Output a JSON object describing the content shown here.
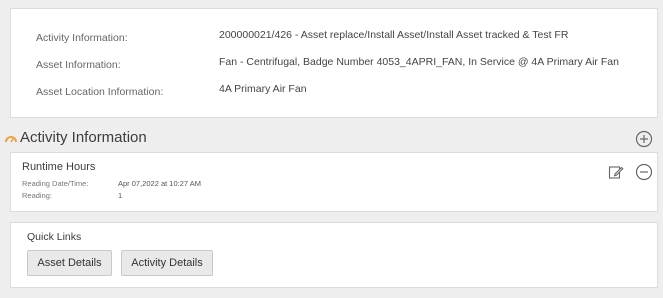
{
  "asset_info": {
    "rows": [
      {
        "label": "Activity Information:",
        "value": "200000021/426 - Asset replace/Install Asset/Install Asset tracked & Test FR"
      },
      {
        "label": "Asset Information:",
        "value": "Fan - Centrifugal, Badge Number 4053_4APRI_FAN, In Service @ 4A Primary Air Fan"
      },
      {
        "label": "Asset Location Information:",
        "value": "4A Primary Air Fan"
      }
    ]
  },
  "activity_section": {
    "title": "Activity Information",
    "icon": "gauge-icon",
    "add_icon": "plus-circle-icon",
    "accent_color": "#e8a33d"
  },
  "reading": {
    "title": "Runtime Hours",
    "date_label": "Reading Date/Time:",
    "date_value": "Apr 07,2022 at 10:27 AM",
    "reading_label": "Reading:",
    "reading_value": "1",
    "edit_icon": "edit-icon",
    "remove_icon": "minus-circle-icon"
  },
  "quick_links": {
    "title": "Quick Links",
    "asset_details_label": "Asset Details",
    "activity_details_label": "Activity Details"
  }
}
